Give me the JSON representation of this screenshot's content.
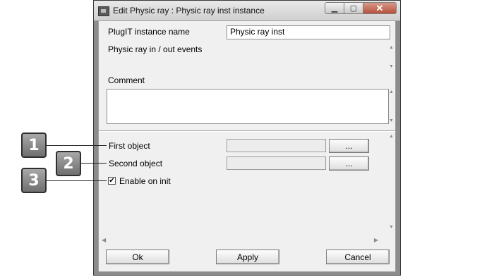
{
  "window": {
    "title": "Edit Physic ray : Physic ray inst instance",
    "controls": {
      "minimize": "▁",
      "maximize": "▢",
      "close": "✕"
    }
  },
  "form": {
    "instance_name_label": "PlugIT instance name",
    "instance_name_value": "Physic ray inst",
    "events_label": "Physic ray in / out events",
    "comment_label": "Comment",
    "comment_value": "",
    "first_object_label": "First object",
    "second_object_label": "Second object",
    "browse_label": "...",
    "enable_on_init_label": "Enable on init",
    "enable_on_init_checked": true,
    "check_mark": "✔"
  },
  "buttons": {
    "ok": "Ok",
    "apply": "Apply",
    "cancel": "Cancel"
  },
  "annotations": {
    "badge_1": "1",
    "badge_2": "2",
    "badge_3": "3"
  },
  "scroll_glyphs": {
    "up": "▲",
    "down": "▼",
    "left": "◀",
    "right": "▶"
  }
}
